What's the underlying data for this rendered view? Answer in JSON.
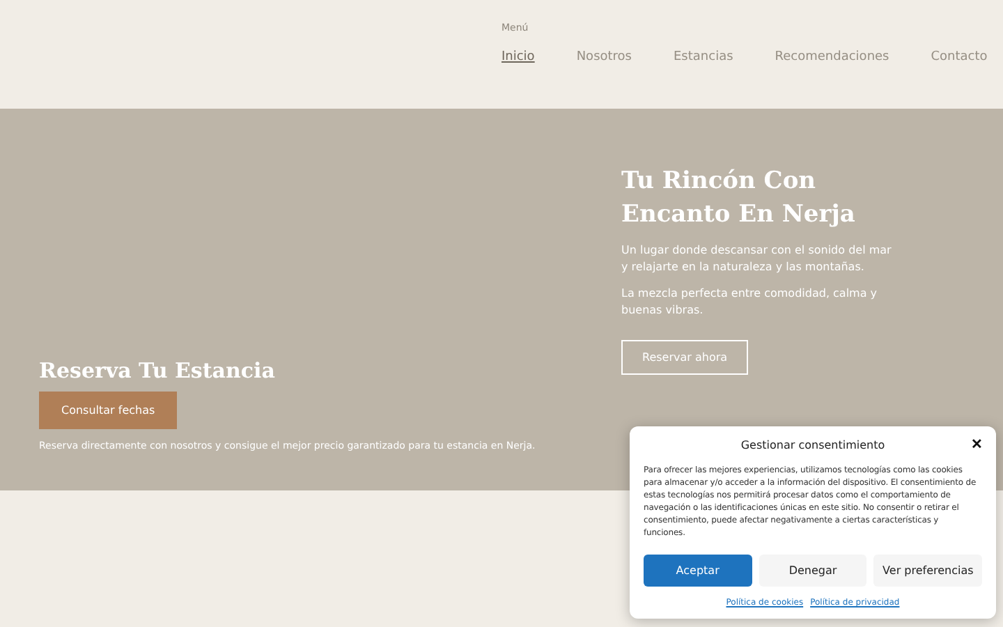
{
  "header": {
    "top_label": "Menú",
    "nav": [
      {
        "label": "Inicio",
        "selected": true
      },
      {
        "label": "Nosotros",
        "selected": false
      },
      {
        "label": "Estancias",
        "selected": false
      },
      {
        "label": "Recomendaciones",
        "selected": false
      },
      {
        "label": "Contacto",
        "selected": false
      }
    ]
  },
  "hero": {
    "title": "Tu Rincón Con Encanto En Nerja",
    "paragraphs": [
      "Un lugar donde descansar con el sonido del mar y relajarte en la naturaleza y las montañas.",
      "La mezcla perfecta entre comodidad, calma y buenas vibras."
    ],
    "button": "Reservar ahora"
  },
  "booking": {
    "title": "Reserva Tu Estancia",
    "button": "Consultar fechas",
    "note": "Reserva directamente con nosotros y consigue el mejor precio garantizado para tu estancia en Nerja."
  },
  "consent": {
    "title": "Gestionar consentimiento",
    "close": "✕",
    "body": "Para ofrecer las mejores experiencias, utilizamos tecnologías como las cookies para almacenar y/o acceder a la información del dispositivo. El consentimiento de estas tecnologías nos permitirá procesar datos como el comportamiento de navegación o las identificaciones únicas en este sitio. No consentir o retirar el consentimiento, puede afectar negativamente a ciertas características y funciones.",
    "buttons": [
      {
        "label": "Aceptar",
        "kind": "primary"
      },
      {
        "label": "Denegar",
        "kind": "secondary"
      },
      {
        "label": "Ver preferencias",
        "kind": "secondary"
      }
    ],
    "links": [
      "Política de cookies",
      "Política de privacidad"
    ]
  }
}
